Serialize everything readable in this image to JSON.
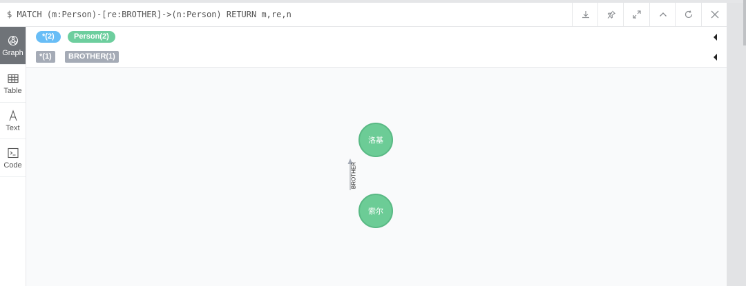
{
  "query": {
    "text": "$ MATCH (m:Person)-[re:BROTHER]->(n:Person) RETURN m,re,n"
  },
  "toolbar": {
    "buttons": [
      "download-icon",
      "pin-icon",
      "expand-icon",
      "collapse-icon",
      "refresh-icon",
      "close-icon"
    ]
  },
  "sidebar": {
    "tabs": [
      {
        "label": "Graph",
        "icon": "graph-icon",
        "active": true
      },
      {
        "label": "Table",
        "icon": "table-icon",
        "active": false
      },
      {
        "label": "Text",
        "icon": "text-icon",
        "active": false
      },
      {
        "label": "Code",
        "icon": "code-icon",
        "active": false
      }
    ]
  },
  "legend": {
    "nodes": [
      {
        "label": "*(2)",
        "color": "#68bdf6"
      },
      {
        "label": "Person(2)",
        "color": "#6dce9e"
      }
    ],
    "relationships": [
      {
        "label": "*(1)"
      },
      {
        "label": "BROTHER(1)"
      }
    ]
  },
  "graph": {
    "nodes": [
      {
        "id": "top",
        "label": "洛基",
        "color": "#6ccc96"
      },
      {
        "id": "bottom",
        "label": "索尔",
        "color": "#6ccc96"
      }
    ],
    "relationship": {
      "type": "BROTHER",
      "from": "bottom",
      "to": "top"
    }
  }
}
